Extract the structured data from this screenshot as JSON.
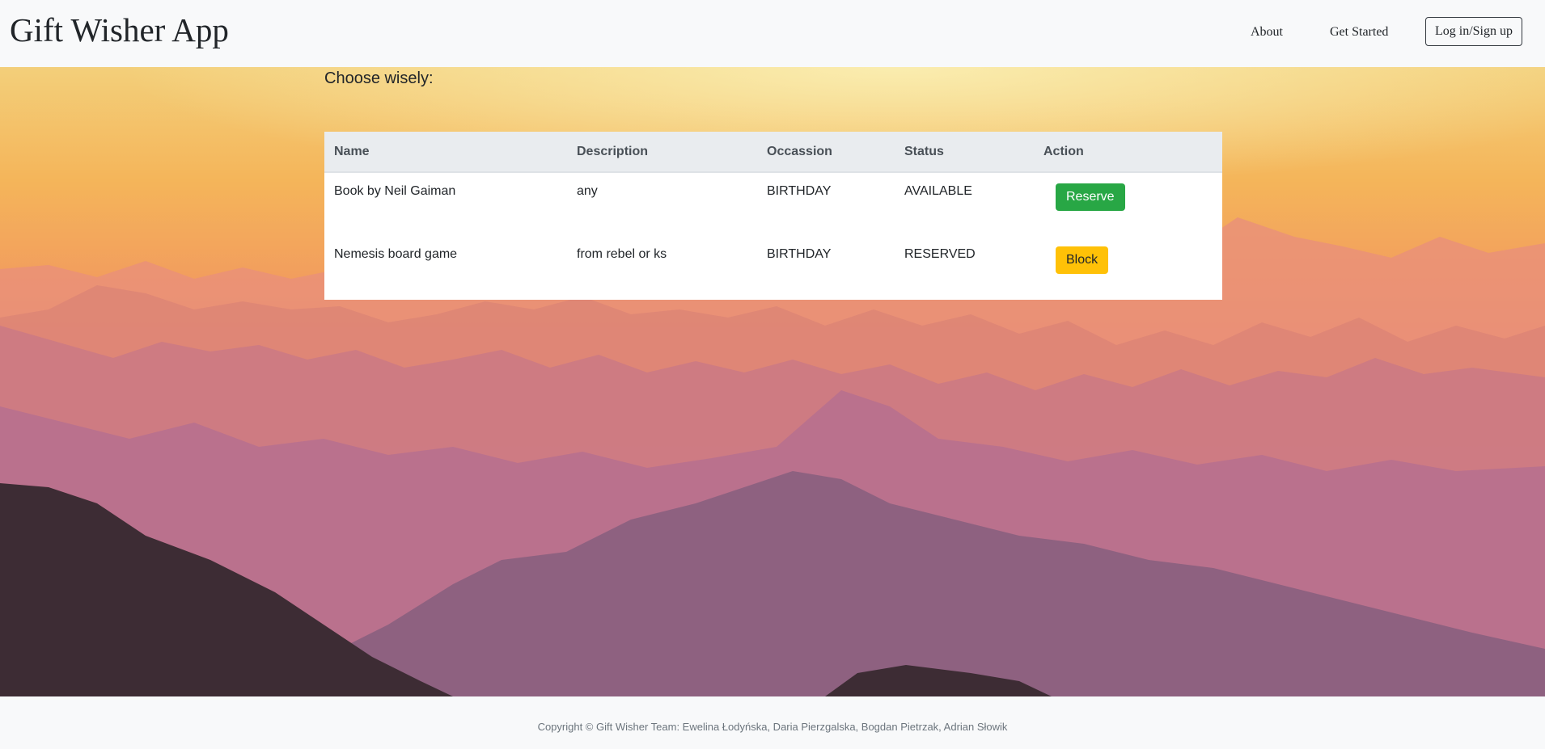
{
  "navbar": {
    "brand": "Gift Wisher App",
    "links": [
      "About",
      "Get Started"
    ],
    "login_label": "Log in/Sign up"
  },
  "main": {
    "heading": "Choose wisely:",
    "table": {
      "headers": [
        "Name",
        "Description",
        "Occassion",
        "Status",
        "Action"
      ],
      "rows": [
        {
          "name": "Book by Neil Gaiman",
          "description": "any",
          "occasion": "BIRTHDAY",
          "status": "AVAILABLE",
          "action": "Reserve"
        },
        {
          "name": "Nemesis board game",
          "description": "from rebel or ks",
          "occasion": "BIRTHDAY",
          "status": "RESERVED",
          "action": "Block"
        }
      ]
    }
  },
  "footer": {
    "copyright": "Copyright © Gift Wisher Team: Ewelina Łodyńska, Daria Pierzgalska, Bogdan Pietrzak, Adrian Słowik"
  },
  "colors": {
    "reserve_button": "#28a745",
    "block_button": "#ffc107",
    "navbar_bg": "#f8f9fa",
    "table_header_bg": "#e9ecef"
  }
}
